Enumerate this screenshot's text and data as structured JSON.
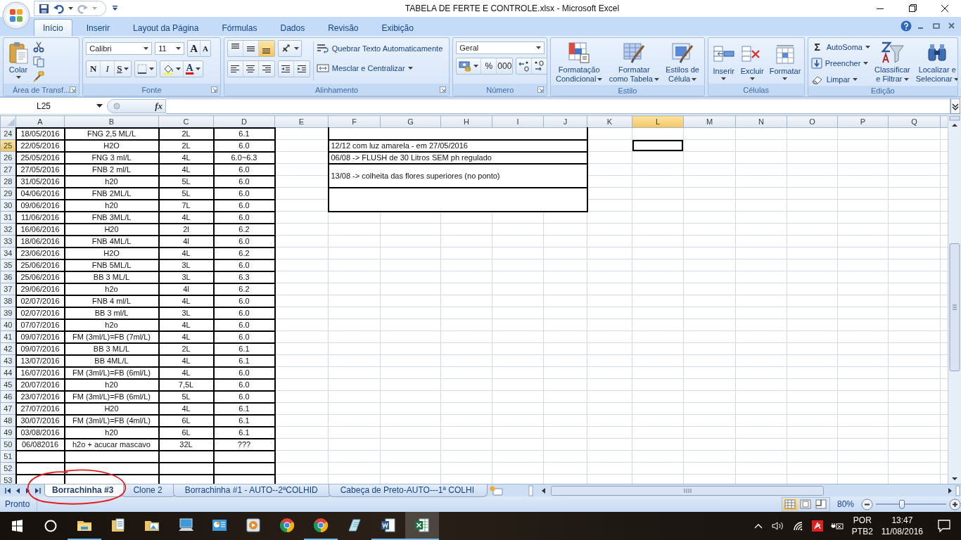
{
  "window": {
    "title": "TABELA DE FERTE E CONTROLE.xlsx - Microsoft Excel"
  },
  "ribbon_tabs": [
    {
      "label": "Início",
      "selected": true
    },
    {
      "label": "Inserir",
      "selected": false
    },
    {
      "label": "Layout da Página",
      "selected": false
    },
    {
      "label": "Fórmulas",
      "selected": false
    },
    {
      "label": "Dados",
      "selected": false
    },
    {
      "label": "Revisão",
      "selected": false
    },
    {
      "label": "Exibição",
      "selected": false
    }
  ],
  "ribbon": {
    "clipboard": {
      "paste": "Colar",
      "label": "Área de Transf..."
    },
    "font": {
      "name": "Calibri",
      "size": "11",
      "grow": "A",
      "shrink": "A",
      "bold": "N",
      "italic": "I",
      "underline": "S",
      "font_color_glyph": "A",
      "label": "Fonte"
    },
    "alignment": {
      "vertical": [
        {
          "selected": false
        },
        {
          "selected": false
        },
        {
          "selected": true
        }
      ],
      "wrap": "Quebrar Texto Automaticamente",
      "merge": "Mesclar e Centralizar",
      "label": "Alinhamento"
    },
    "number": {
      "format": "Geral",
      "percent": "%",
      "thousands": "000",
      "label": "Número"
    },
    "styles": {
      "buttons": [
        [
          "Formatação",
          "Condicional"
        ],
        [
          "Formatar",
          "como Tabela"
        ],
        [
          "Estilos de",
          "Célula"
        ]
      ],
      "label": "Estilo"
    },
    "cells": {
      "buttons": [
        "Inserir",
        "Excluir",
        "Formatar"
      ],
      "label": "Células"
    },
    "editing": {
      "sum_symbol": "Σ",
      "autosum": "AutoSoma",
      "fill": "Preencher",
      "clear": "Limpar",
      "buttons": [
        [
          "Classificar",
          "e Filtrar"
        ],
        [
          "Localizar e",
          "Selecionar"
        ]
      ],
      "label": "Edição"
    }
  },
  "formula_bar": {
    "name_box": "L25",
    "function_label": "fx"
  },
  "columns": [
    {
      "letter": "A",
      "selected": false
    },
    {
      "letter": "B",
      "selected": false
    },
    {
      "letter": "C",
      "selected": false
    },
    {
      "letter": "D",
      "selected": false
    },
    {
      "letter": "E",
      "selected": false
    },
    {
      "letter": "F",
      "selected": false
    },
    {
      "letter": "G",
      "selected": false
    },
    {
      "letter": "H",
      "selected": false
    },
    {
      "letter": "I",
      "selected": false
    },
    {
      "letter": "J",
      "selected": false
    },
    {
      "letter": "K",
      "selected": false
    },
    {
      "letter": "L",
      "selected": true
    },
    {
      "letter": "M",
      "selected": false
    },
    {
      "letter": "N",
      "selected": false
    },
    {
      "letter": "O",
      "selected": false
    },
    {
      "letter": "P",
      "selected": false
    },
    {
      "letter": "Q",
      "selected": false
    }
  ],
  "rows": [
    {
      "number": "24",
      "selected": false,
      "cells": [
        "18/05/2016",
        "FNG 2,5 ML/L",
        "2L",
        "6.1"
      ]
    },
    {
      "number": "25",
      "selected": true,
      "cells": [
        "22/05/2016",
        "H2O",
        "2L",
        "6.0"
      ]
    },
    {
      "number": "26",
      "selected": false,
      "cells": [
        "25/05/2016",
        "FNG 3 ml/L",
        "4L",
        "6.0~6.3"
      ]
    },
    {
      "number": "27",
      "selected": false,
      "cells": [
        "27/05/2016",
        "FNB 2 ml/L",
        "4L",
        "6.0"
      ]
    },
    {
      "number": "28",
      "selected": false,
      "cells": [
        "31/05/2016",
        "h20",
        "5L",
        "6.0"
      ]
    },
    {
      "number": "29",
      "selected": false,
      "cells": [
        "04/06/2016",
        "FNB 2ML/L",
        "5L",
        "6.0"
      ]
    },
    {
      "number": "30",
      "selected": false,
      "cells": [
        "09/06/2016",
        "h20",
        "7L",
        "6.0"
      ]
    },
    {
      "number": "31",
      "selected": false,
      "cells": [
        "11/06/2016",
        "FNB 3ML/L",
        "4L",
        "6.0"
      ]
    },
    {
      "number": "32",
      "selected": false,
      "cells": [
        "16/06/2016",
        "H20",
        "2l",
        "6.2"
      ]
    },
    {
      "number": "33",
      "selected": false,
      "cells": [
        "18/06/2016",
        "FNB 4ML/L",
        "4l",
        "6.0"
      ]
    },
    {
      "number": "34",
      "selected": false,
      "cells": [
        "23/06/2016",
        "H2O",
        "4L",
        "6.2"
      ]
    },
    {
      "number": "35",
      "selected": false,
      "cells": [
        "25/06/2016",
        "FNB 5ML/L",
        "3L",
        "6.0"
      ]
    },
    {
      "number": "36",
      "selected": false,
      "cells": [
        "25/06/2016",
        "BB 3 ML/L",
        "3L",
        "6.3"
      ]
    },
    {
      "number": "37",
      "selected": false,
      "cells": [
        "29/06/2016",
        "h2o",
        "4l",
        "6.2"
      ]
    },
    {
      "number": "38",
      "selected": false,
      "cells": [
        "02/07/2016",
        "FNB 4 ml/L",
        "4L",
        "6.0"
      ]
    },
    {
      "number": "39",
      "selected": false,
      "cells": [
        "02/07/2016",
        "BB 3 ml/L",
        "3L",
        "6.0"
      ]
    },
    {
      "number": "40",
      "selected": false,
      "cells": [
        "07/07/2016",
        "h2o",
        "4L",
        "6.0"
      ]
    },
    {
      "number": "41",
      "selected": false,
      "cells": [
        "09/07/2016",
        "FM (3ml/L)=FB (7ml/L)",
        "4L",
        "6.0"
      ]
    },
    {
      "number": "42",
      "selected": false,
      "cells": [
        "09/07/2016",
        "BB 3 ML/L",
        "2L",
        "6.1"
      ]
    },
    {
      "number": "43",
      "selected": false,
      "cells": [
        "13/07/2016",
        "BB 4ML/L",
        "4L",
        "6.1"
      ]
    },
    {
      "number": "44",
      "selected": false,
      "cells": [
        "16/07/2016",
        "FM (3ml/L)=FB (6ml/L)",
        "4L",
        "6.0"
      ]
    },
    {
      "number": "45",
      "selected": false,
      "cells": [
        "20/07/2016",
        "h20",
        "7,5L",
        "6.0"
      ]
    },
    {
      "number": "46",
      "selected": false,
      "cells": [
        "23/07/2016",
        "FM (3ml/L)=FB (6ml/L)",
        "5L",
        "6.0"
      ]
    },
    {
      "number": "47",
      "selected": false,
      "cells": [
        "27/07/2016",
        "H20",
        "4L",
        "6.1"
      ]
    },
    {
      "number": "48",
      "selected": false,
      "cells": [
        "30/07/2016",
        "FM (3ml/L)=FB (4ml/L)",
        "6L",
        "6.1"
      ]
    },
    {
      "number": "49",
      "selected": false,
      "cells": [
        "03/08/2016",
        "h20",
        "6L",
        "6.1"
      ]
    },
    {
      "number": "50",
      "selected": false,
      "cells": [
        "06/082016",
        "h2o + acucar mascavo",
        "32L",
        "???"
      ]
    },
    {
      "number": "51",
      "selected": false
    },
    {
      "number": "52",
      "selected": false
    },
    {
      "number": "53",
      "selected": false
    }
  ],
  "notes": [
    "12/12 com luz amarela - em 27/05/2016",
    "06/08 -> FLUSH de 30 Litros SEM ph regulado",
    "13/08 -> colheita das flores superiores (no ponto)"
  ],
  "sheet_tabs": [
    {
      "label": "Borrachinha #3",
      "selected": true
    },
    {
      "label": "Clone 2",
      "selected": false
    },
    {
      "label": "Borrachinha #1 - AUTO--2ªCOLHID",
      "selected": false
    },
    {
      "label": "Cabeça de Preto-AUTO---1ª COLHI",
      "selected": false
    }
  ],
  "status_bar": {
    "text": "Pronto",
    "views": [
      {
        "selected": true
      },
      {
        "selected": false
      },
      {
        "selected": false
      }
    ],
    "zoom": "80%",
    "zoom_slider": {
      "level": 0.37
    }
  },
  "taskbar": {
    "apps": [
      {
        "running": true,
        "selected": false
      },
      {
        "running": false,
        "selected": false
      },
      {
        "running": false,
        "selected": false
      },
      {
        "running": false,
        "selected": false
      },
      {
        "running": false,
        "selected": false
      },
      {
        "running": false,
        "selected": false
      },
      {
        "running": false,
        "selected": false
      },
      {
        "running": true,
        "selected": false
      },
      {
        "running": false,
        "selected": false
      },
      {
        "running": true,
        "selected": false
      },
      {
        "running": true,
        "selected": true
      }
    ],
    "language": "POR",
    "layout": "PTB2",
    "time": "13:47",
    "date": "11/08/2016"
  }
}
